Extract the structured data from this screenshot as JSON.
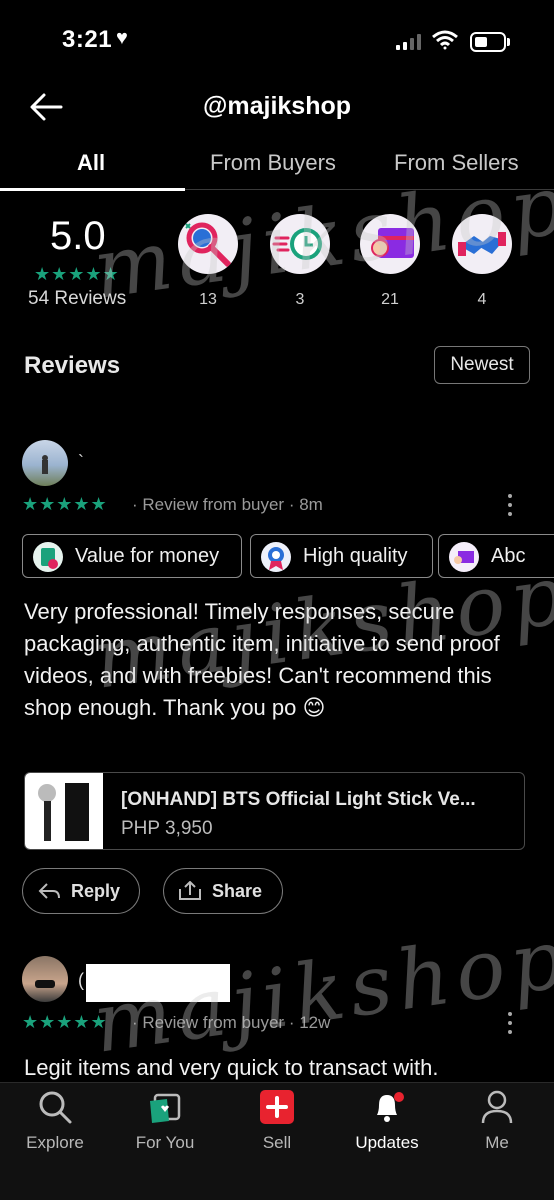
{
  "status_bar": {
    "time": "3:21"
  },
  "header": {
    "title": "@majikshop"
  },
  "tabs": [
    {
      "label": "All",
      "active": true
    },
    {
      "label": "From Buyers",
      "active": false
    },
    {
      "label": "From Sellers",
      "active": false
    }
  ],
  "summary": {
    "rating": "5.0",
    "stars": "★★★★★",
    "review_count": "54 Reviews",
    "badges": [
      {
        "icon": "magnifier-hand-icon",
        "count": "13"
      },
      {
        "icon": "fast-clock-icon",
        "count": "3"
      },
      {
        "icon": "ok-hand-box-icon",
        "count": "21"
      },
      {
        "icon": "handshake-icon",
        "count": "4"
      }
    ]
  },
  "reviews_section": {
    "title": "Reviews",
    "sort_label": "Newest"
  },
  "reviews": [
    {
      "name": "`",
      "stars": "★★★★★",
      "meta": "· Review from buyer · 8m",
      "tags": [
        "Value for money",
        "High quality",
        "Abc"
      ],
      "text": "Very professional! Timely responses, secure packaging, authentic item, initiative to send proof videos, and with freebies! Can't recommend this shop enough. Thank you po 😊",
      "product": {
        "name": "[ONHAND] BTS Official Light Stick Ve...",
        "price": "PHP 3,950"
      },
      "actions": {
        "reply": "Reply",
        "share": "Share"
      }
    },
    {
      "name": "(",
      "stars": "★★★★★",
      "meta": "· Review from buyer · 12w",
      "text": "Legit items and very quick to transact with."
    }
  ],
  "watermark": "majikshop",
  "bottom_nav": [
    {
      "label": "Explore",
      "icon": "search-icon"
    },
    {
      "label": "For You",
      "icon": "for-you-icon"
    },
    {
      "label": "Sell",
      "icon": "plus-box-icon"
    },
    {
      "label": "Updates",
      "icon": "bell-icon"
    },
    {
      "label": "Me",
      "icon": "person-icon"
    }
  ],
  "colors": {
    "accent": "#1aa27c",
    "sell": "#e8232f",
    "notification": "#e8232f"
  }
}
